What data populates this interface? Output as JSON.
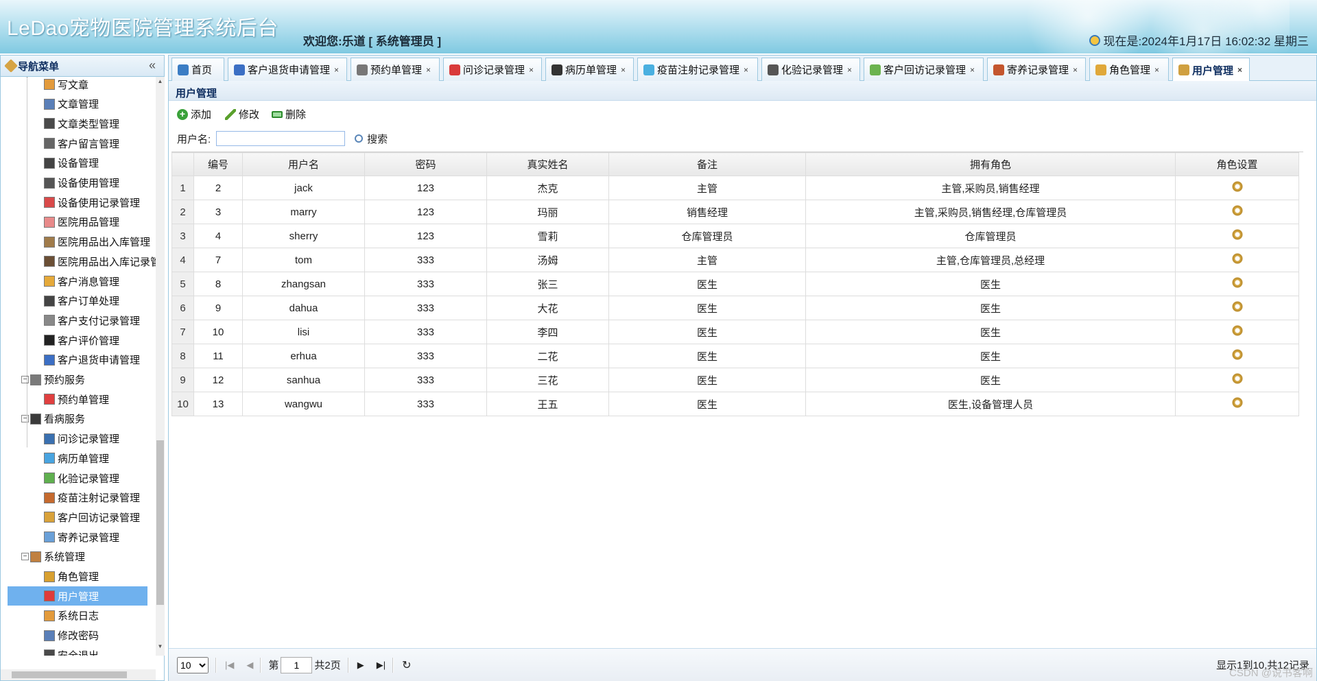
{
  "header": {
    "app_title": "LeDao宠物医院管理系统后台",
    "welcome": "欢迎您:乐道 [ 系统管理员 ]",
    "clock": "现在是:2024年1月17日 16:02:32 星期三"
  },
  "sidebar": {
    "title": "导航菜单",
    "collapse": "«",
    "items": [
      {
        "label": "写文章",
        "icon": "write-icon"
      },
      {
        "label": "文章管理",
        "icon": "article-icon"
      },
      {
        "label": "文章类型管理",
        "icon": "category-icon"
      },
      {
        "label": "客户留言管理",
        "icon": "message-icon"
      },
      {
        "label": "设备管理",
        "icon": "device-icon"
      },
      {
        "label": "设备使用管理",
        "icon": "device-use-icon"
      },
      {
        "label": "设备使用记录管理",
        "icon": "device-record-icon"
      },
      {
        "label": "医院用品管理",
        "icon": "supply-icon"
      },
      {
        "label": "医院用品出入库管理",
        "icon": "stock-icon"
      },
      {
        "label": "医院用品出入库记录管理",
        "icon": "stock-record-icon"
      },
      {
        "label": "客户消息管理",
        "icon": "notice-icon"
      },
      {
        "label": "客户订单处理",
        "icon": "order-icon"
      },
      {
        "label": "客户支付记录管理",
        "icon": "payment-icon"
      },
      {
        "label": "客户评价管理",
        "icon": "thumb-icon"
      },
      {
        "label": "客户退货申请管理",
        "icon": "grid-icon"
      }
    ],
    "group_appointment": "预约服务",
    "appointment_items": [
      {
        "label": "预约单管理"
      }
    ],
    "group_visit": "看病服务",
    "visit_items": [
      {
        "label": "问诊记录管理"
      },
      {
        "label": "病历单管理"
      },
      {
        "label": "化验记录管理"
      },
      {
        "label": "疫苗注射记录管理"
      },
      {
        "label": "客户回访记录管理"
      },
      {
        "label": "寄养记录管理"
      }
    ],
    "group_system": "系统管理",
    "system_items": [
      {
        "label": "角色管理"
      },
      {
        "label": "用户管理"
      },
      {
        "label": "系统日志"
      },
      {
        "label": "修改密码"
      },
      {
        "label": "安全退出"
      }
    ],
    "selected": "用户管理"
  },
  "tabs": [
    {
      "label": "首页",
      "close": false
    },
    {
      "label": "客户退货申请管理",
      "close": true
    },
    {
      "label": "预约单管理",
      "close": true
    },
    {
      "label": "问诊记录管理",
      "close": true
    },
    {
      "label": "病历单管理",
      "close": true
    },
    {
      "label": "疫苗注射记录管理",
      "close": true
    },
    {
      "label": "化验记录管理",
      "close": true
    },
    {
      "label": "客户回访记录管理",
      "close": true
    },
    {
      "label": "寄养记录管理",
      "close": true
    },
    {
      "label": "角色管理",
      "close": true
    },
    {
      "label": "用户管理",
      "close": true
    }
  ],
  "close_glyph": "×",
  "panel": {
    "title": "用户管理",
    "add_label": "添加",
    "edit_label": "修改",
    "delete_label": "删除",
    "search_label": "用户名:",
    "search_value": "",
    "search_button": "搜索"
  },
  "table": {
    "columns": [
      "编号",
      "用户名",
      "密码",
      "真实姓名",
      "备注",
      "拥有角色",
      "角色设置"
    ],
    "rows": [
      {
        "rn": "1",
        "id": "2",
        "username": "jack",
        "password": "123",
        "realname": "杰克",
        "remark": "主管",
        "roles": "主管,采购员,销售经理"
      },
      {
        "rn": "2",
        "id": "3",
        "username": "marry",
        "password": "123",
        "realname": "玛丽",
        "remark": "销售经理",
        "roles": "主管,采购员,销售经理,仓库管理员"
      },
      {
        "rn": "3",
        "id": "4",
        "username": "sherry",
        "password": "123",
        "realname": "雪莉",
        "remark": "仓库管理员",
        "roles": "仓库管理员"
      },
      {
        "rn": "4",
        "id": "7",
        "username": "tom",
        "password": "333",
        "realname": "汤姆",
        "remark": "主管",
        "roles": "主管,仓库管理员,总经理"
      },
      {
        "rn": "5",
        "id": "8",
        "username": "zhangsan",
        "password": "333",
        "realname": "张三",
        "remark": "医生",
        "roles": "医生"
      },
      {
        "rn": "6",
        "id": "9",
        "username": "dahua",
        "password": "333",
        "realname": "大花",
        "remark": "医生",
        "roles": "医生"
      },
      {
        "rn": "7",
        "id": "10",
        "username": "lisi",
        "password": "333",
        "realname": "李四",
        "remark": "医生",
        "roles": "医生"
      },
      {
        "rn": "8",
        "id": "11",
        "username": "erhua",
        "password": "333",
        "realname": "二花",
        "remark": "医生",
        "roles": "医生"
      },
      {
        "rn": "9",
        "id": "12",
        "username": "sanhua",
        "password": "333",
        "realname": "三花",
        "remark": "医生",
        "roles": "医生"
      },
      {
        "rn": "10",
        "id": "13",
        "username": "wangwu",
        "password": "333",
        "realname": "王五",
        "remark": "医生",
        "roles": "医生,设备管理人员"
      }
    ]
  },
  "pager": {
    "page_size": "10",
    "page_prefix": "第",
    "page_value": "1",
    "page_suffix": "共2页",
    "info": "显示1到10,共12记录",
    "first": "|◀",
    "prev": "◀",
    "next": "▶",
    "last": "▶|",
    "refresh": "↻"
  },
  "watermark": "CSDN @说书客啊"
}
